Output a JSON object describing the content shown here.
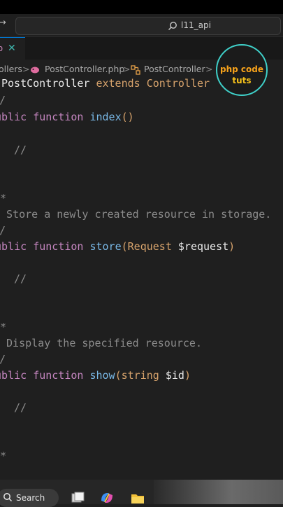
{
  "search": {
    "text": "l11_api"
  },
  "tab": {
    "ext_label": "o",
    "close_glyph": "✕"
  },
  "breadcrumb": {
    "items": [
      "ollers",
      "PostController.php",
      "PostController"
    ],
    "separator": ">"
  },
  "logo": {
    "line1": "php code",
    "line2": "tuts"
  },
  "code": {
    "line1": {
      "cls": "PostController",
      "extends": "extends",
      "parent": "Controller"
    },
    "index": {
      "mod": "ublic",
      "kw": "function",
      "name": "index",
      "parens": "()"
    },
    "comment1": "//",
    "doc_star1": "*",
    "store_doc": " Store a newly created resource in storage.",
    "doc_end1": "/",
    "store": {
      "mod": "ublic",
      "kw": "function",
      "name": "store",
      "open": "(",
      "type": "Request",
      "var": " $request",
      "close": ")"
    },
    "comment2": "//",
    "doc_star2": "*",
    "show_doc": " Display the specified resource.",
    "doc_end2": "/",
    "show": {
      "mod": "ublic",
      "kw": "function",
      "name": "show",
      "open": "(",
      "type": "string",
      "var": " $id",
      "close": ")"
    },
    "comment3": "//",
    "doc_star3": "*",
    "slash_top": "/"
  },
  "taskbar": {
    "search_label": "Search"
  },
  "colors": {
    "accent": "#0078d4",
    "logo_ring": "#3fd0c9",
    "logo_text": "#f7a21b"
  }
}
